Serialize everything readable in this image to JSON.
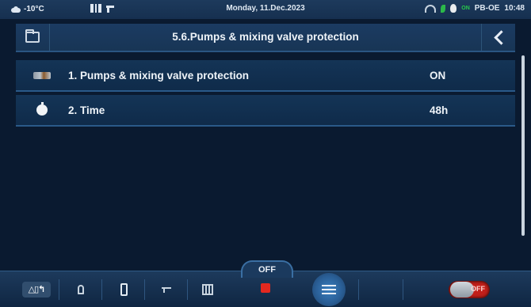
{
  "status_bar": {
    "outdoor_temp": "-10°C",
    "date": "Monday, 11.Dec.2023",
    "on_badge": "ON",
    "model": "PB-OE",
    "time": "10:48"
  },
  "header": {
    "title": "5.6.Pumps & mixing valve protection"
  },
  "rows": [
    {
      "label": "1. Pumps & mixing valve protection",
      "value": "ON",
      "icon": "valve-icon"
    },
    {
      "label": "2. Time",
      "value": "48h",
      "icon": "clock-icon"
    }
  ],
  "bottom_bar": {
    "mode_label": "△▯↰",
    "off_label": "OFF",
    "toggle_label": "OFF"
  },
  "colors": {
    "background": "#0a1a30",
    "row": "#143456",
    "stop": "#e3281f",
    "toggle_off": "#c11f1a"
  }
}
